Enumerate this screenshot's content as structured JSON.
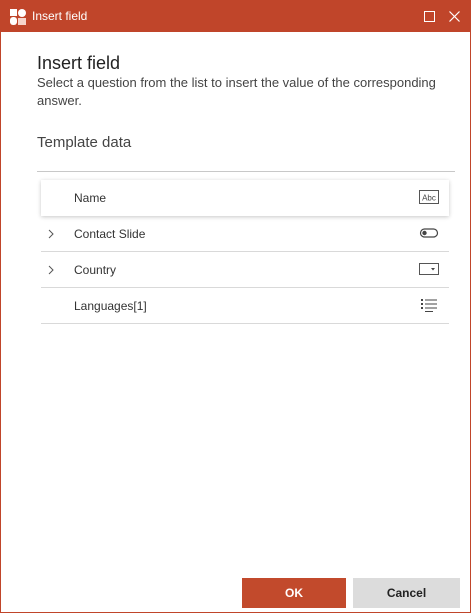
{
  "window": {
    "title": "Insert field",
    "accent_color": "#c0452a",
    "icons": [
      "app-logo-icon",
      "maximize-icon",
      "close-icon"
    ]
  },
  "dialog": {
    "heading": "Insert field",
    "description": "Select a question from the list to insert the value of the corresponding answer.",
    "section_title": "Template data"
  },
  "fields": [
    {
      "label": "Name",
      "expandable": false,
      "selected": true,
      "type_icon": "text-field-icon",
      "type_icon_text": "Abc"
    },
    {
      "label": "Contact Slide",
      "expandable": true,
      "selected": false,
      "type_icon": "toggle-icon"
    },
    {
      "label": "Country",
      "expandable": true,
      "selected": false,
      "type_icon": "dropdown-icon"
    },
    {
      "label": "Languages[1]",
      "expandable": false,
      "selected": false,
      "type_icon": "list-icon"
    }
  ],
  "buttons": {
    "ok_label": "OK",
    "cancel_label": "Cancel"
  }
}
